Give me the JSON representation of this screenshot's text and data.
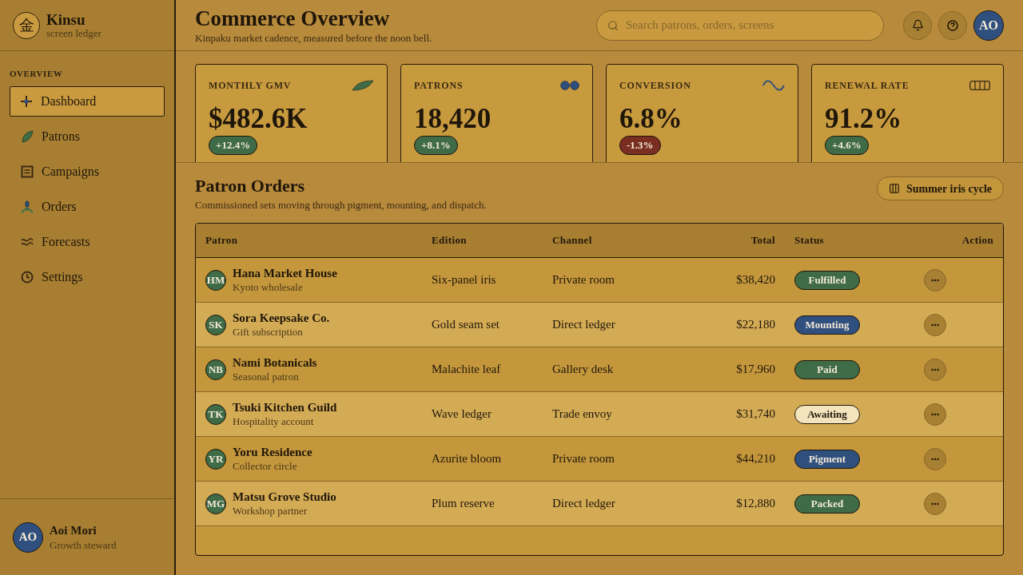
{
  "sidebar": {
    "brand": {
      "logo": "金",
      "name": "Kinsu",
      "tagline": "screen ledger"
    },
    "section_label": "OVERVIEW",
    "items": [
      {
        "label": "Dashboard",
        "selected": true
      },
      {
        "label": "Patrons",
        "selected": false
      },
      {
        "label": "Campaigns",
        "selected": false
      },
      {
        "label": "Orders",
        "selected": false
      },
      {
        "label": "Forecasts",
        "selected": false
      },
      {
        "label": "Settings",
        "selected": false
      }
    ],
    "user": {
      "initials": "AO",
      "name": "Aoi Mori",
      "role": "Growth steward"
    }
  },
  "header": {
    "title": "Commerce Overview",
    "subtitle": "Kinpaku market cadence, measured before the noon bell.",
    "search": {
      "placeholder": "Search patrons, orders, screens"
    },
    "avatar": "AO"
  },
  "kpis": [
    {
      "label": "MONTHLY GMV",
      "value": "$482.6K",
      "delta": "+12.4%",
      "color": "#3f6b47"
    },
    {
      "label": "PATRONS",
      "value": "18,420",
      "delta": "+8.1%",
      "color": "#3f6b47"
    },
    {
      "label": "CONVERSION",
      "value": "6.8%",
      "delta": "-1.3%",
      "color": "#7a2e22"
    },
    {
      "label": "RENEWAL RATE",
      "value": "91.2%",
      "delta": "+4.6%",
      "color": "#3f6b47"
    }
  ],
  "orders": {
    "title": "Patron Orders",
    "subtitle": "Commissioned sets moving through pigment, mounting, and dispatch.",
    "cycle_button": "Summer iris cycle",
    "columns": [
      "Patron",
      "Edition",
      "Channel",
      "Total",
      "Status",
      "Action"
    ],
    "rows": [
      {
        "initials": "HM",
        "name": "Hana Market House",
        "segment": "Kyoto wholesale",
        "edition": "Six-panel iris",
        "channel": "Private room",
        "total": "$38,420",
        "status": {
          "label": "Fulfilled",
          "color": "#3f6b47"
        }
      },
      {
        "initials": "SK",
        "name": "Sora Keepsake Co.",
        "segment": "Gift subscription",
        "edition": "Gold seam set",
        "channel": "Direct ledger",
        "total": "$22,180",
        "status": {
          "label": "Mounting",
          "color": "#2f4f7f"
        }
      },
      {
        "initials": "NB",
        "name": "Nami Botanicals",
        "segment": "Seasonal patron",
        "edition": "Malachite leaf",
        "channel": "Gallery desk",
        "total": "$17,960",
        "status": {
          "label": "Paid",
          "color": "#3f6b47"
        }
      },
      {
        "initials": "TK",
        "name": "Tsuki Kitchen Guild",
        "segment": "Hospitality account",
        "edition": "Wave ledger",
        "channel": "Trade envoy",
        "total": "$31,740",
        "status": {
          "label": "Awaiting",
          "color": "#f3e4bd"
        }
      },
      {
        "initials": "YR",
        "name": "Yoru Residence",
        "segment": "Collector circle",
        "edition": "Azurite bloom",
        "channel": "Private room",
        "total": "$44,210",
        "status": {
          "label": "Pigment",
          "color": "#2f4f7f"
        }
      },
      {
        "initials": "MG",
        "name": "Matsu Grove Studio",
        "segment": "Workshop partner",
        "edition": "Plum reserve",
        "channel": "Direct ledger",
        "total": "$12,880",
        "status": {
          "label": "Packed",
          "color": "#3f6b47"
        }
      }
    ]
  }
}
